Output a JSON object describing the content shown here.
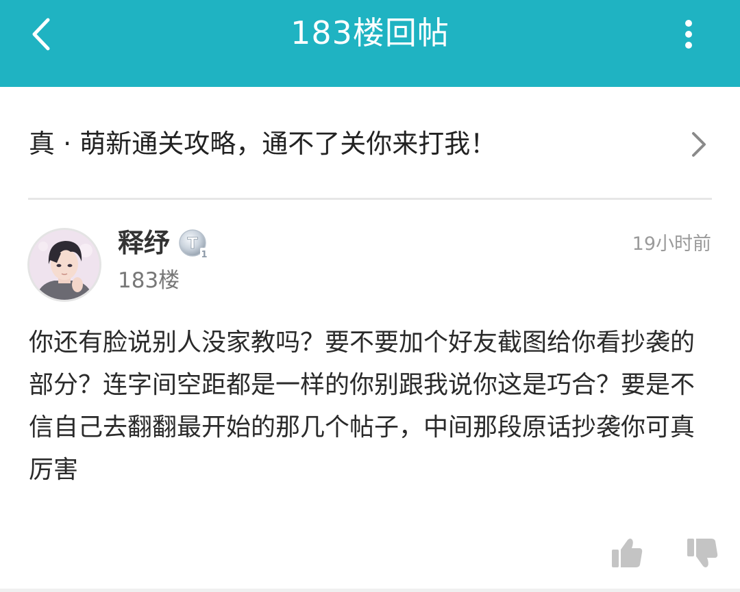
{
  "header": {
    "title": "183楼回帖",
    "background_color": "#1fb3c2",
    "back_icon": "chevron-left-icon",
    "more_icon": "more-vertical-icon"
  },
  "thread": {
    "title": "真 · 萌新通关攻略，通不了关你来打我！",
    "chevron_icon": "chevron-right-icon"
  },
  "post": {
    "author": "释纾",
    "level_badge_text": "T",
    "level_badge_number": "1",
    "floor": "183楼",
    "time": "19小时前",
    "content": "你还有脸说别人没家教吗？要不要加个好友截图给你看抄袭的部分？连字间空距都是一样的你别跟我说你这是巧合？要是不信自己去翻翻最开始的那几个帖子，中间那段原话抄袭你可真厉害"
  },
  "actions": {
    "like_icon": "thumbs-up-icon",
    "dislike_icon": "thumbs-down-icon"
  }
}
